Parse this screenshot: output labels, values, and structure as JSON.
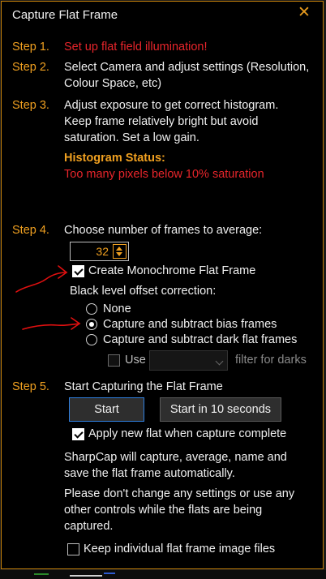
{
  "window": {
    "title": "Capture Flat Frame"
  },
  "steps": {
    "s1": {
      "label": "Step 1.",
      "text": "Set up flat field illumination!"
    },
    "s2": {
      "label": "Step 2.",
      "line1": "Select Camera and adjust settings (Resolution,",
      "line2": "Colour Space, etc)"
    },
    "s3": {
      "label": "Step 3.",
      "line1": "Adjust exposure to get correct histogram.",
      "line2": "Keep frame relatively bright but avoid",
      "line3": "saturation. Set a low gain."
    },
    "histogram": {
      "heading": "Histogram Status:",
      "status": "Too many pixels below 10% saturation"
    },
    "s4": {
      "label": "Step 4.",
      "text": "Choose number of frames to average:"
    },
    "s5": {
      "label": "Step 5.",
      "text": "Start Capturing the Flat Frame"
    }
  },
  "frames": {
    "value": "32"
  },
  "monochrome": {
    "label": "Create Monochrome Flat Frame",
    "checked": true
  },
  "black_level": {
    "label": "Black level offset correction:",
    "options": [
      "None",
      "Capture and subtract bias frames",
      "Capture and subtract dark flat frames"
    ],
    "selected": "Capture and subtract bias frames"
  },
  "use_filter": {
    "label": "Use",
    "suffix": "filter for darks",
    "checked": false,
    "value": ""
  },
  "buttons": {
    "start": "Start",
    "start_delay": "Start in 10 seconds"
  },
  "apply_flat": {
    "label": "Apply new flat when capture complete",
    "checked": true
  },
  "info": {
    "line1": "SharpCap will capture, average, name and",
    "line2": "save the flat frame automatically.",
    "line3": "Please don't change any settings or use any",
    "line4": "other controls while the flats are being",
    "line5": "captured."
  },
  "keep_files": {
    "label": "Keep individual flat frame image files",
    "checked": false
  },
  "colors": {
    "accent": "#f0a020",
    "error": "#e8252b",
    "focus": "#2f7fe0",
    "background": "#000000"
  },
  "icons": {
    "close": "close-icon",
    "spin_up": "triangle-up-icon",
    "spin_down": "triangle-down-icon",
    "dropdown": "chevron-down-icon"
  }
}
